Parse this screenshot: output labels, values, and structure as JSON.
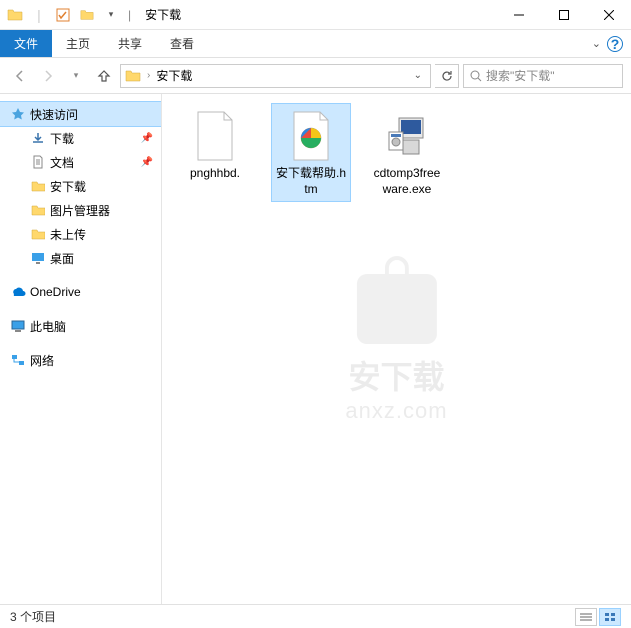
{
  "titlebar": {
    "title": "安下载",
    "separator": "|",
    "qat_dropdown": true
  },
  "window_controls": {
    "min": "–",
    "max": "☐",
    "close": "✕"
  },
  "ribbon": {
    "tabs": [
      {
        "id": "file",
        "label": "文件"
      },
      {
        "id": "home",
        "label": "主页"
      },
      {
        "id": "share",
        "label": "共享"
      },
      {
        "id": "view",
        "label": "查看"
      }
    ],
    "expand": "⌄",
    "help": "?"
  },
  "address": {
    "crumbs": [
      "安下载"
    ],
    "dropdown": "⌄",
    "refresh": "↻",
    "search_placeholder": "搜索\"安下载\""
  },
  "sidebar": {
    "quick_access": "快速访问",
    "items": [
      {
        "label": "下载",
        "pinned": true,
        "icon": "download"
      },
      {
        "label": "文档",
        "pinned": true,
        "icon": "document"
      },
      {
        "label": "安下载",
        "pinned": false,
        "icon": "folder"
      },
      {
        "label": "图片管理器",
        "pinned": false,
        "icon": "folder"
      },
      {
        "label": "未上传",
        "pinned": false,
        "icon": "folder"
      },
      {
        "label": "桌面",
        "pinned": false,
        "icon": "desktop"
      }
    ],
    "onedrive": "OneDrive",
    "this_pc": "此电脑",
    "network": "网络"
  },
  "files": [
    {
      "name": "pnghhbd.",
      "type": "blank"
    },
    {
      "name": "安下载帮助.htm",
      "type": "htm",
      "selected": true
    },
    {
      "name": "cdtomp3freeware.exe",
      "type": "exe"
    }
  ],
  "watermark": {
    "line1": "安下载",
    "line2": "anxz.com"
  },
  "status": {
    "text": "3 个项目"
  }
}
